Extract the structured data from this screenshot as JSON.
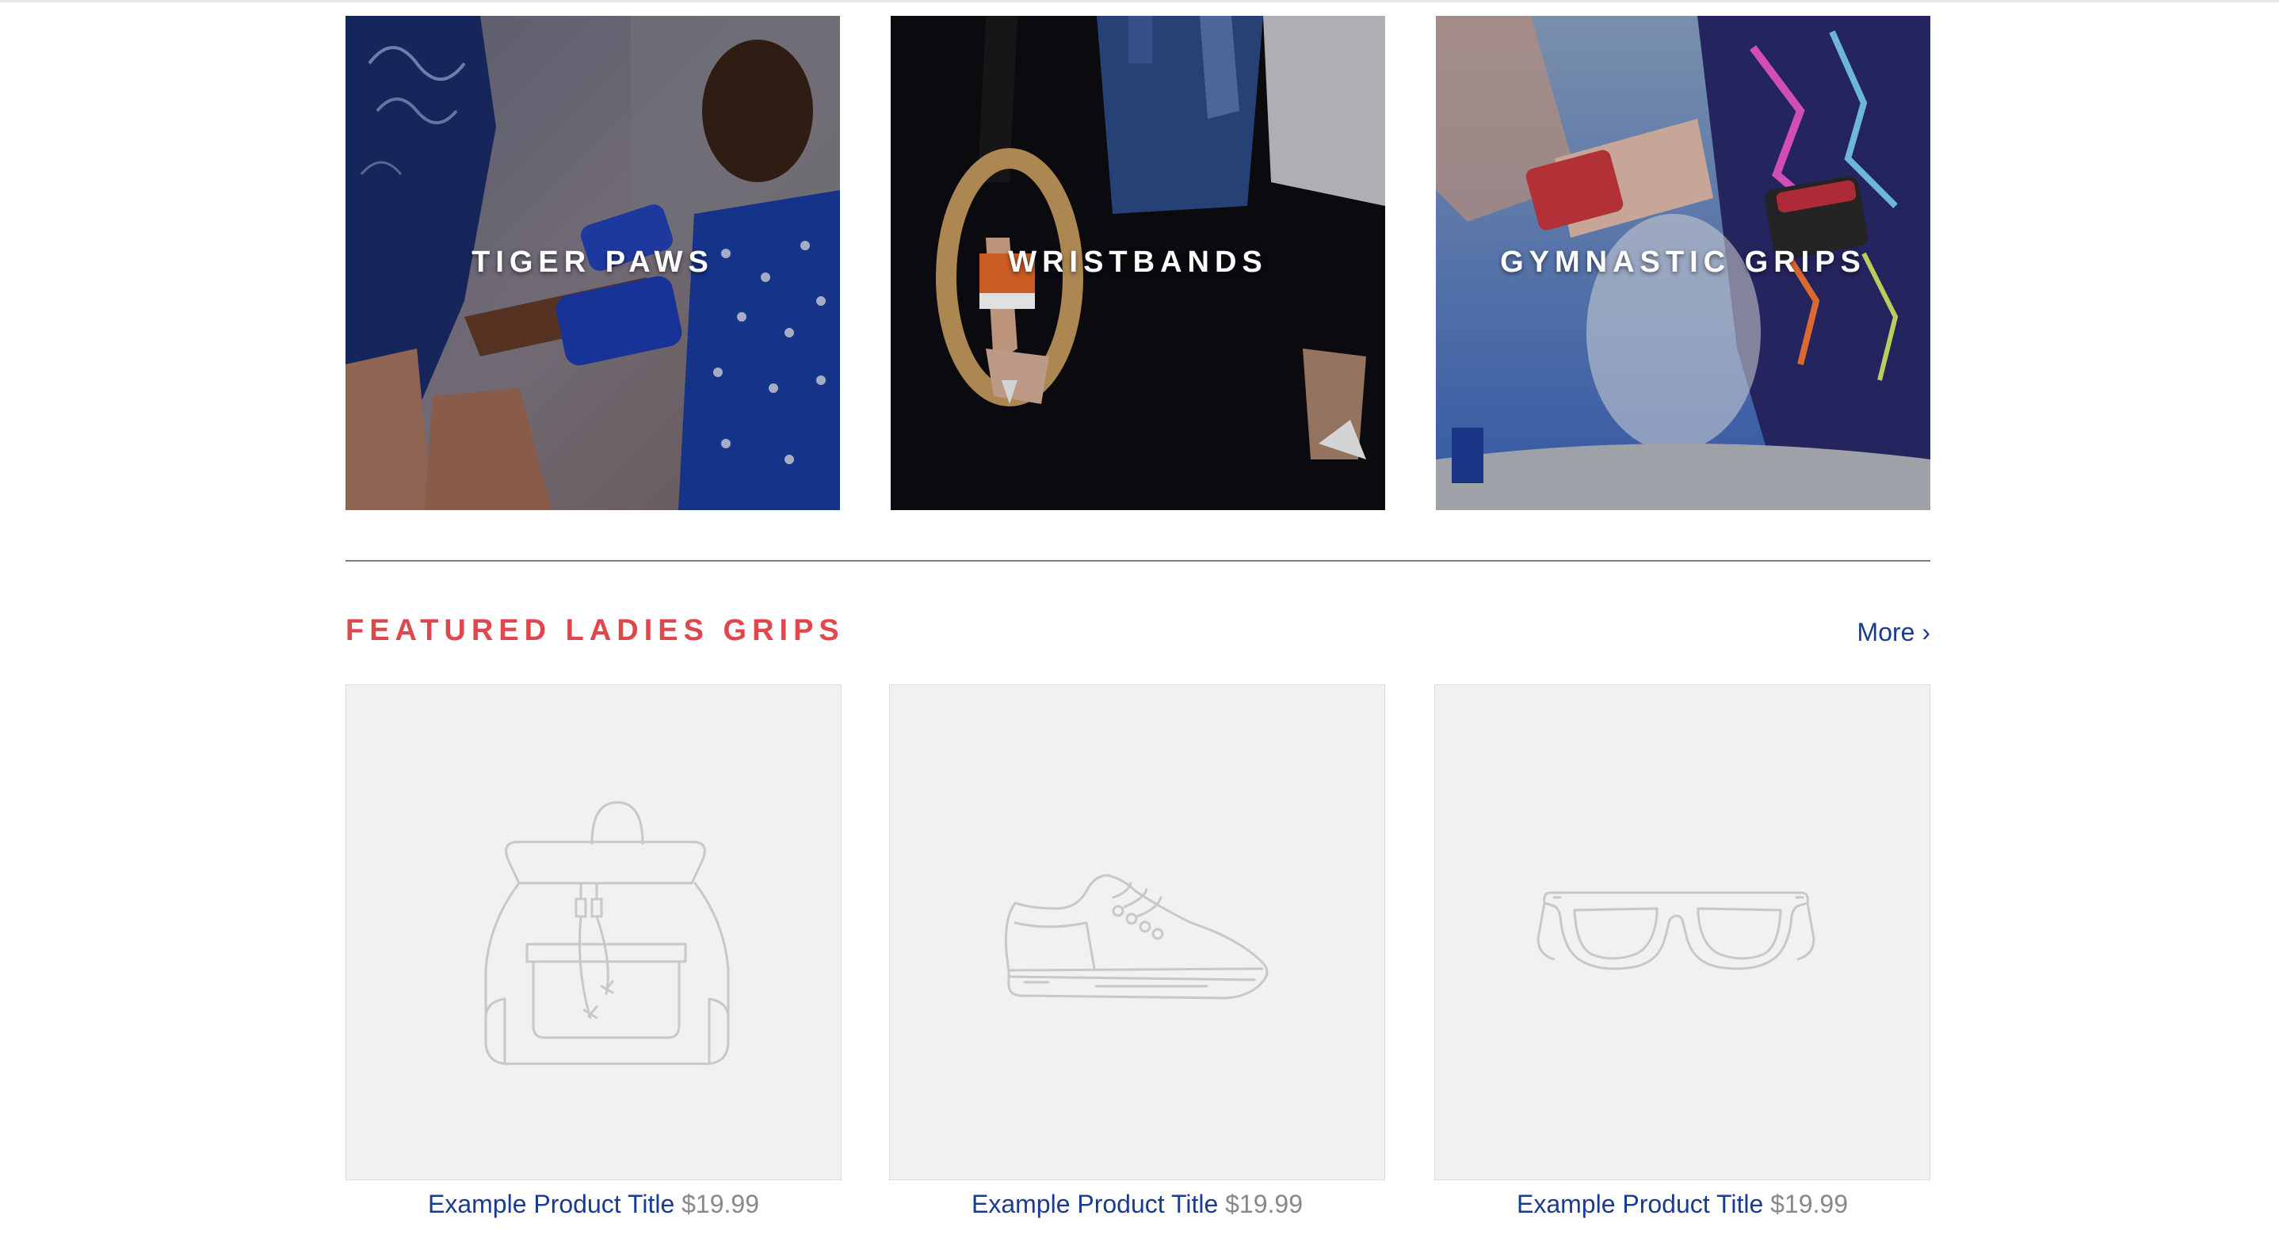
{
  "collections": [
    {
      "title": "TIGER PAWS"
    },
    {
      "title": "WRISTBANDS"
    },
    {
      "title": "GYMNASTIC GRIPS"
    }
  ],
  "featured": {
    "title": "FEATURED LADIES GRIPS",
    "more_label": "More ›",
    "products": [
      {
        "icon": "backpack-icon",
        "title": "Example Product Title",
        "price": "$19.99"
      },
      {
        "icon": "sneaker-icon",
        "title": "Example Product Title",
        "price": "$19.99"
      },
      {
        "icon": "sunglasses-icon",
        "title": "Example Product Title",
        "price": "$19.99"
      }
    ]
  },
  "colors": {
    "accent_red": "#e0474c",
    "link_blue": "#1a3b8f",
    "price_gray": "#888888",
    "placeholder_bg": "#f1f1f1",
    "icon_stroke": "#c8c8c8"
  }
}
